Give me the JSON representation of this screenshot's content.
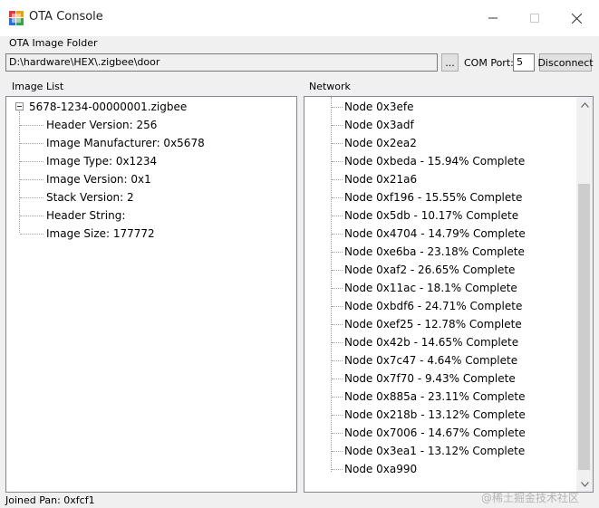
{
  "window": {
    "title": "OTA Console"
  },
  "toolbar": {
    "folder_label": "OTA Image Folder",
    "folder_path": "D:\\hardware\\HEX\\.zigbee\\door",
    "browse_label": "...",
    "com_port_label": "COM Port:",
    "com_port_value": "5",
    "disconnect_label": "Disconnect"
  },
  "image_list": {
    "heading": "Image List",
    "file_name": "5678-1234-00000001.zigbee",
    "properties": [
      "Header Version: 256",
      "Image Manufacturer: 0x5678",
      "Image Type: 0x1234",
      "Image Version: 0x1",
      "Stack Version: 2",
      "Header String:",
      "Image Size: 177772"
    ]
  },
  "network": {
    "heading": "Network",
    "nodes": [
      "Node 0x3efe",
      "Node 0x3adf",
      "Node 0x2ea2",
      "Node 0xbeda - 15.94% Complete",
      "Node 0x21a6",
      "Node 0xf196 - 15.55% Complete",
      "Node 0x5db - 10.17% Complete",
      "Node 0x4704 - 14.79% Complete",
      "Node 0xe6ba - 23.18% Complete",
      "Node 0xaf2 - 26.65% Complete",
      "Node 0x11ac - 18.1% Complete",
      "Node 0xbdf6 - 24.71% Complete",
      "Node 0xef25 - 12.78% Complete",
      "Node 0x42b - 14.65% Complete",
      "Node 0x7c47 - 4.64% Complete",
      "Node 0x7f70 - 9.43% Complete",
      "Node 0x885a - 23.11% Complete",
      "Node 0x218b - 13.12% Complete",
      "Node 0x7006 - 14.67% Complete",
      "Node 0x3ea1 - 13.12% Complete",
      "Node 0xa990"
    ]
  },
  "status_bar": {
    "text": "Joined Pan: 0xfcf1"
  },
  "watermark": "@稀土掘金技术社区"
}
